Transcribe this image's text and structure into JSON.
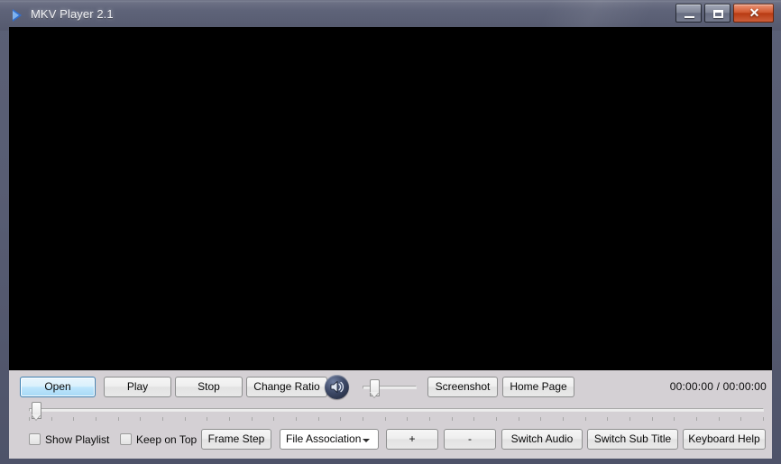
{
  "window": {
    "title": "MKV Player 2.1",
    "app_icon": "play-triangle-icon",
    "controls": {
      "minimize_label": "minimize-icon",
      "maximize_label": "maximize-icon",
      "close_label": "✕"
    },
    "frame_color": "#585d73",
    "titlebar_text_color": "#f2f3f7"
  },
  "video": {
    "background_color": "#000000"
  },
  "controls_row": {
    "open_label": "Open",
    "play_label": "Play",
    "stop_label": "Stop",
    "change_ratio_label": "Change Ratio",
    "volume_icon": "speaker-volume-icon",
    "screenshot_label": "Screenshot",
    "home_page_label": "Home Page",
    "time_display": "00:00:00 / 00:00:00",
    "volume_value": 18
  },
  "seek": {
    "position": 0,
    "tick_count": 34
  },
  "bottom_row": {
    "show_playlist_label": "Show Playlist",
    "show_playlist_checked": false,
    "keep_on_top_label": "Keep on Top",
    "keep_on_top_checked": false,
    "frame_step_label": "Frame Step",
    "file_association_label": "File Association",
    "plus_label": "+",
    "minus_label": "-",
    "switch_audio_label": "Switch Audio",
    "switch_sub_title_label": "Switch Sub Title",
    "keyboard_help_label": "Keyboard Help"
  },
  "colors": {
    "panel_bg": "#d4d0d4",
    "focus_blue": "#3c7fb1",
    "close_red": "#c94a22"
  }
}
